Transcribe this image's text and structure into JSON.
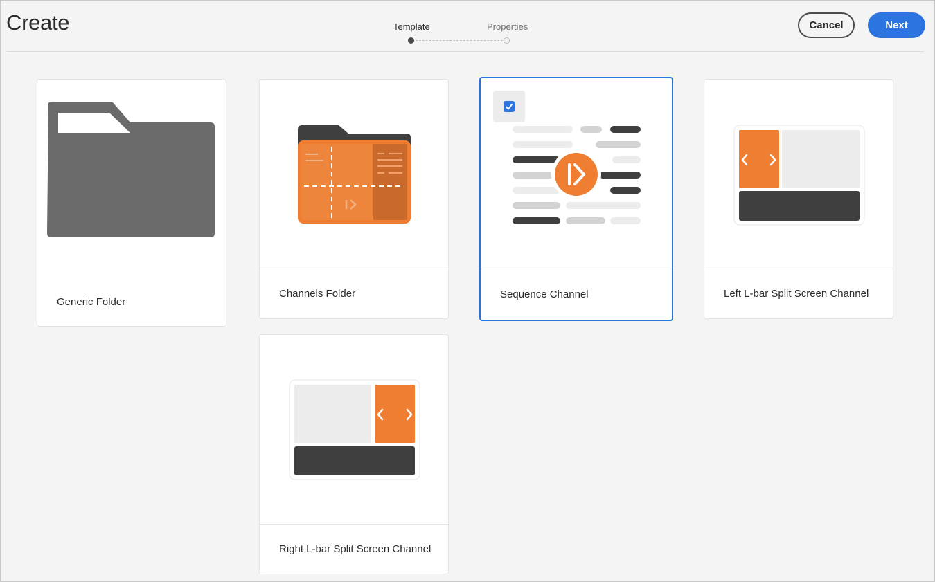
{
  "header": {
    "title": "Create",
    "steps": [
      {
        "label": "Template",
        "state": "active"
      },
      {
        "label": "Properties",
        "state": "inactive"
      }
    ],
    "cancel_label": "Cancel",
    "next_label": "Next"
  },
  "cards": [
    {
      "label": "Generic Folder",
      "icon": "generic-folder-icon",
      "selected": false
    },
    {
      "label": "Channels Folder",
      "icon": "channels-folder-icon",
      "selected": false
    },
    {
      "label": "Sequence Channel",
      "icon": "sequence-channel-icon",
      "selected": true
    },
    {
      "label": "Left L-bar Split Screen Channel",
      "icon": "left-lbar-split-icon",
      "selected": false
    },
    {
      "label": "Right L-bar Split Screen Channel",
      "icon": "right-lbar-split-icon",
      "selected": false
    }
  ],
  "colors": {
    "accent": "#2c74e0",
    "orange": "#ef7e32",
    "dark": "#3f3f3f",
    "folder_gray": "#6b6b6b"
  }
}
